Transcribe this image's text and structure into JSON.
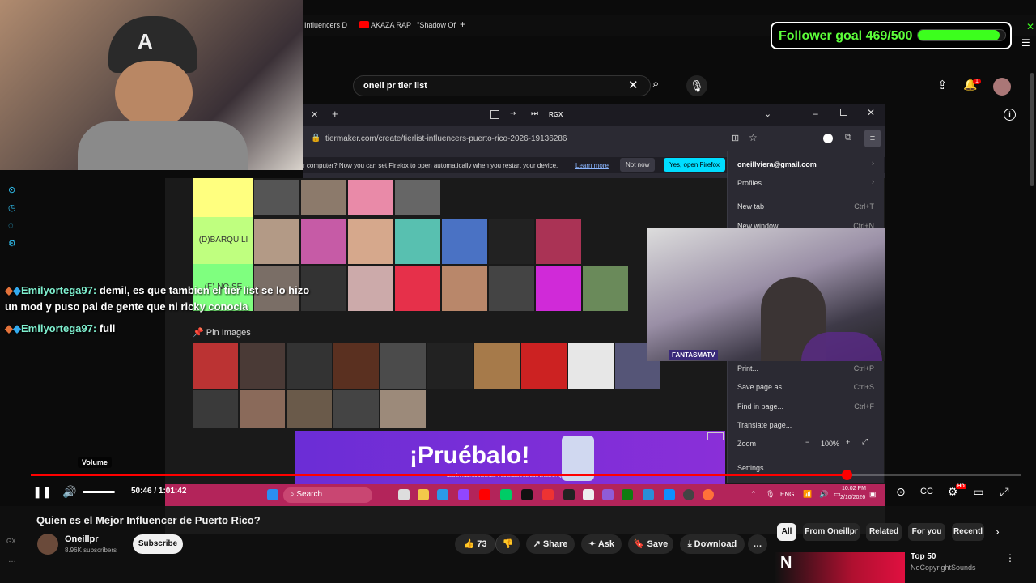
{
  "browser_tabs": {
    "tab1": "Influencers D",
    "tab2": "AKAZA RAP | \"Shadow Of"
  },
  "youtube": {
    "search_query": "oneil pr tier list",
    "notification_count": "1"
  },
  "firefox": {
    "toolbar_label": "RGX",
    "url": "tiermaker.com/create/tierlist-influencers-puerto-rico-2026-19136286",
    "notification_text": "r computer? Now you can set Firefox to open automatically when you restart your device.",
    "learn_more": "Learn more",
    "not_now": "Not now",
    "open_firefox": "Yes, open Firefox",
    "tiers": [
      "",
      "(D)BARQUILI",
      "(F) NO SE"
    ],
    "pin_images": "Pin Images",
    "menu": {
      "account": "oneillviera@gmail.com",
      "profiles": "Profiles",
      "new_tab": "New tab",
      "new_tab_sc": "Ctrl+T",
      "new_window": "New window",
      "new_window_sc": "Ctrl+N",
      "print": "Print...",
      "print_sc": "Ctrl+P",
      "save_page": "Save page as...",
      "save_page_sc": "Ctrl+S",
      "find": "Find in page...",
      "find_sc": "Ctrl+F",
      "translate": "Translate page...",
      "zoom": "Zoom",
      "zoom_value": "100%",
      "settings": "Settings"
    }
  },
  "follower_goal": {
    "label": "Follower goal 469/500",
    "current": 469,
    "target": 500
  },
  "chat": [
    {
      "user": "Emilyortega97:",
      "text": "demil, es que tambien el tier list se lo hizo",
      "text2": "un mod y puso pal de gente que ni ricky conocia"
    },
    {
      "user": "Emilyortega97:",
      "text": "full"
    }
  ],
  "ad": {
    "headline": "¡Pruébalo!",
    "fine_print": "*SEGÚN INSTRUCCIONES Y CUIDADOS DE USO EN LA ETIQUETA"
  },
  "taskbar": {
    "search": "Search",
    "lang": "ENG",
    "time": "10:02 PM",
    "date": "2/10/2026"
  },
  "cam2_label": "FANTASMATV",
  "player": {
    "volume_tooltip": "Volume",
    "time": "50:46 / 1:01:42",
    "progress_fraction": 0.823,
    "hd_badge": "HD"
  },
  "video": {
    "title": "Quien es el Mejor Influencer de Puerto Rico?",
    "channel": "Oneillpr",
    "subscribers": "8.96K subscribers",
    "subscribe": "Subscribe",
    "likes": "73",
    "share": "Share",
    "ask": "Ask",
    "save": "Save",
    "download": "Download"
  },
  "sidebar_chips": [
    "All",
    "From Oneillpr",
    "Related",
    "For you",
    "Recentl"
  ],
  "recommended": {
    "title": "Top 50",
    "subtitle": "NoCopyrightSounds"
  },
  "left_icons": {
    "gx": "GX"
  },
  "colors": {
    "accent_red": "#ff0000",
    "goal_green": "#3cff1d",
    "chat_user": "#7ff0cf",
    "taskbar": "#b3245a",
    "ad_purple": "#7a2ed8"
  }
}
